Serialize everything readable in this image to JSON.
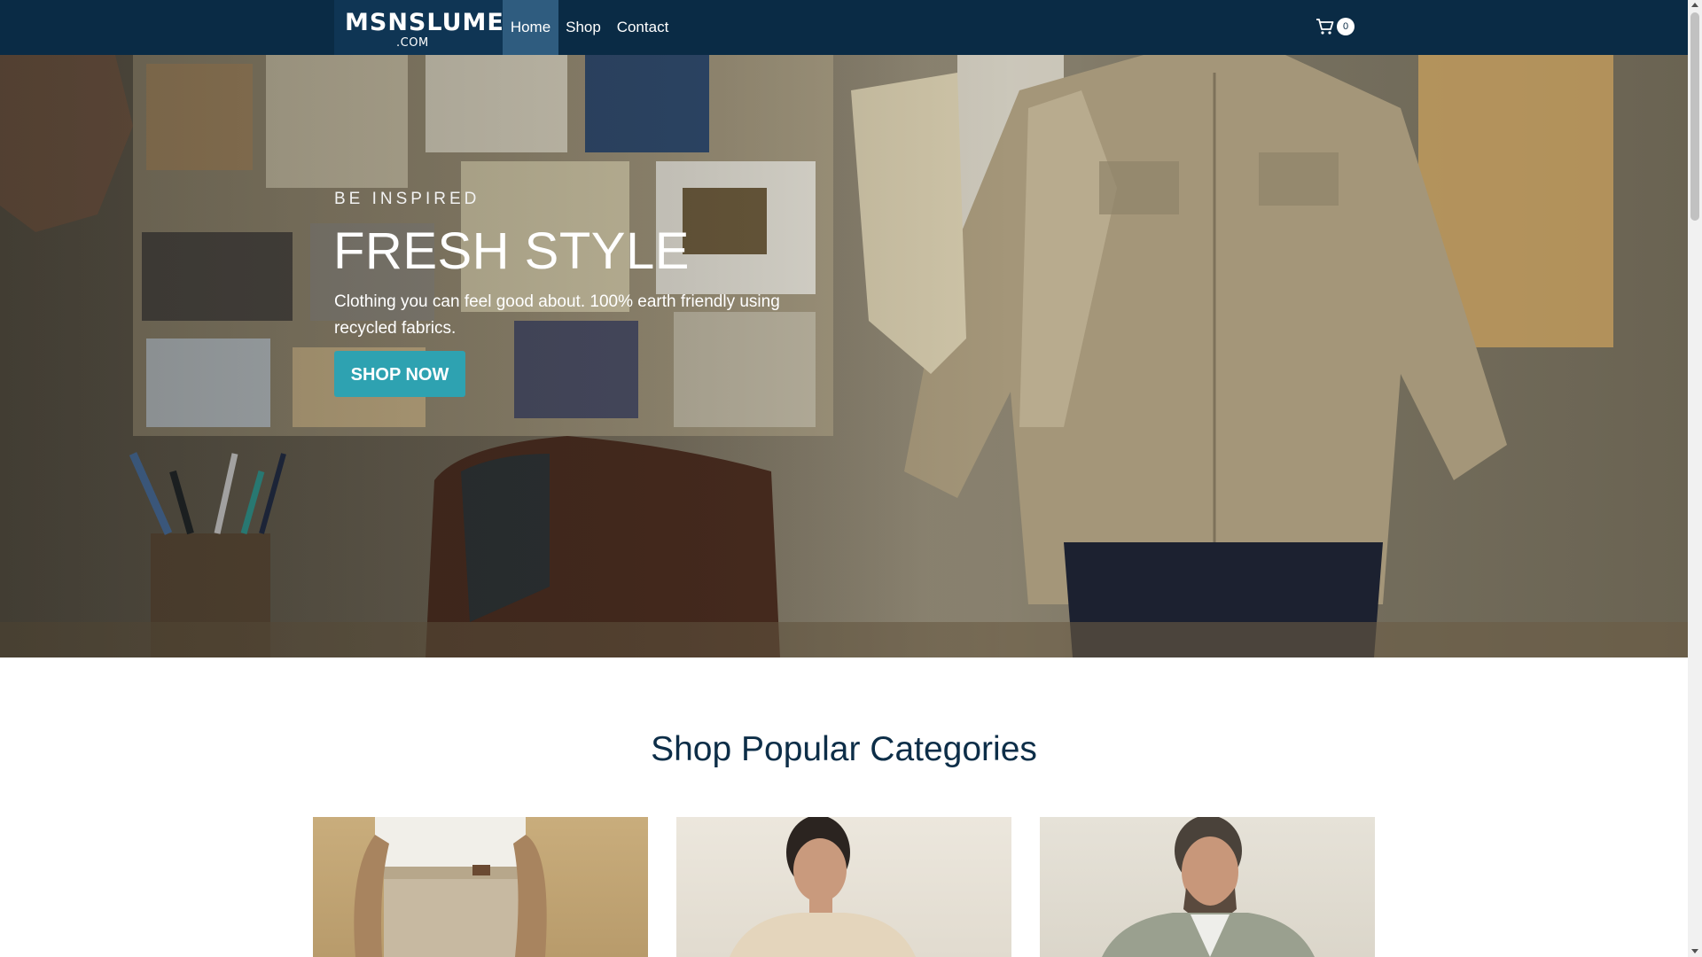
{
  "brand": {
    "logo_main": "MSNSLUME",
    "logo_sub": ".COM"
  },
  "nav": {
    "items": [
      {
        "label": "Home"
      },
      {
        "label": "Shop"
      },
      {
        "label": "Contact"
      }
    ]
  },
  "cart": {
    "count": "0",
    "icon": "cart-icon"
  },
  "hero": {
    "eyebrow": "BE INSPIRED",
    "title": "FRESH STYLE",
    "description": "Clothing you can feel good about. 100% earth friendly using recycled fabrics.",
    "button_label": "SHOP NOW"
  },
  "categories": {
    "title": "Shop Popular Categories"
  },
  "colors": {
    "navbar": "#0a2b45",
    "nav_active": "#2f5c7f",
    "accent_button": "#2ea2b1",
    "heading": "#0d2e48"
  }
}
